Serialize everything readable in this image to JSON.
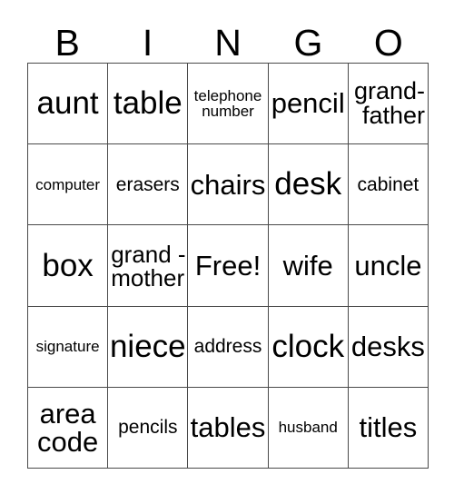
{
  "card": {
    "title": "BINGO",
    "header_letters": [
      "B",
      "I",
      "N",
      "G",
      "O"
    ],
    "columns": 5,
    "rows": 5,
    "free_space_label": "Free!",
    "free_space_position": {
      "row": 3,
      "column": 3
    },
    "colors": {
      "background": "#ffffff",
      "text": "#000000",
      "grid_line": "#4a4a4a"
    },
    "cells": [
      [
        {
          "text": "aunt",
          "size": "xl",
          "lines": 1,
          "align": "center"
        },
        {
          "text": "table",
          "size": "xl",
          "lines": 1,
          "align": "center"
        },
        {
          "text": "telephone\nnumber",
          "size": "xs",
          "lines": 2,
          "align": "center"
        },
        {
          "text": "pencil",
          "size": "lg",
          "lines": 1,
          "align": "center"
        },
        {
          "text": "grand-\nfather",
          "size": "md",
          "lines": 2,
          "align": "right"
        }
      ],
      [
        {
          "text": "computer",
          "size": "xs",
          "lines": 1,
          "align": "center"
        },
        {
          "text": "erasers",
          "size": "sm",
          "lines": 1,
          "align": "center"
        },
        {
          "text": "chairs",
          "size": "lg",
          "lines": 1,
          "align": "center"
        },
        {
          "text": "desk",
          "size": "xl",
          "lines": 1,
          "align": "center"
        },
        {
          "text": "cabinet",
          "size": "sm",
          "lines": 1,
          "align": "center"
        }
      ],
      [
        {
          "text": "box",
          "size": "xl",
          "lines": 1,
          "align": "center"
        },
        {
          "text": "grand -\nmother",
          "size": "md",
          "lines": 2,
          "align": "left"
        },
        {
          "text": "Free!",
          "size": "lg",
          "lines": 1,
          "align": "center"
        },
        {
          "text": "wife",
          "size": "lg",
          "lines": 1,
          "align": "center"
        },
        {
          "text": "uncle",
          "size": "lg",
          "lines": 1,
          "align": "center"
        }
      ],
      [
        {
          "text": "signature",
          "size": "xs",
          "lines": 1,
          "align": "center"
        },
        {
          "text": "niece",
          "size": "xl",
          "lines": 1,
          "align": "center"
        },
        {
          "text": "address",
          "size": "sm",
          "lines": 1,
          "align": "center"
        },
        {
          "text": "clock",
          "size": "xl",
          "lines": 1,
          "align": "center"
        },
        {
          "text": "desks",
          "size": "lg",
          "lines": 1,
          "align": "center"
        }
      ],
      [
        {
          "text": "area\ncode",
          "size": "lg",
          "lines": 2,
          "align": "center"
        },
        {
          "text": "pencils",
          "size": "sm",
          "lines": 1,
          "align": "center"
        },
        {
          "text": "tables",
          "size": "lg",
          "lines": 1,
          "align": "center"
        },
        {
          "text": "husband",
          "size": "xs",
          "lines": 1,
          "align": "center"
        },
        {
          "text": "titles",
          "size": "lg",
          "lines": 1,
          "align": "center"
        }
      ]
    ]
  }
}
